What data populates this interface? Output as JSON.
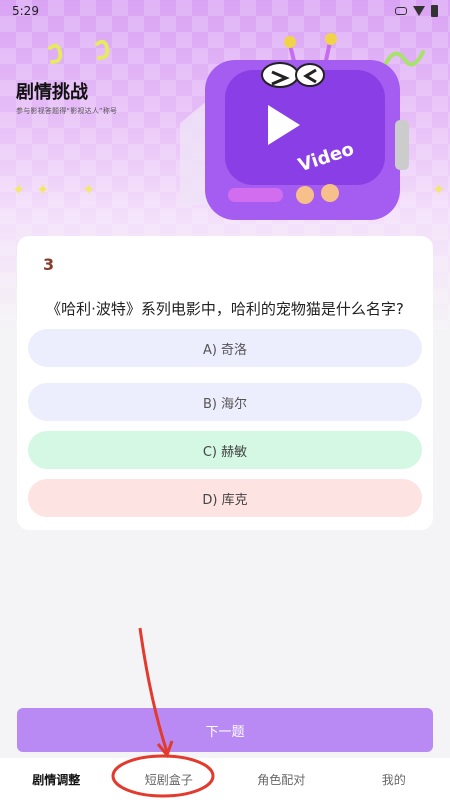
{
  "status_bar": {
    "time": "5:29"
  },
  "header": {
    "title": "剧情挑战",
    "subtitle": "参与影视答题得“影视达人”称号"
  },
  "illustration": {
    "tv_text": "Video"
  },
  "question": {
    "number": "3",
    "text": "《哈利·波特》系列电影中，哈利的宠物猫是什么名字?",
    "options": [
      {
        "label": "A) 奇洛",
        "state": "default"
      },
      {
        "label": "B) 海尔",
        "state": "default"
      },
      {
        "label": "C) 赫敏",
        "state": "correct"
      },
      {
        "label": "D) 库克",
        "state": "wrong"
      }
    ]
  },
  "next_button": {
    "label": "下一题"
  },
  "tabbar": {
    "tabs": [
      {
        "label": "剧情调整",
        "active": true
      },
      {
        "label": "短剧盒子",
        "active": false
      },
      {
        "label": "角色配对",
        "active": false
      },
      {
        "label": "我的",
        "active": false
      }
    ]
  },
  "colors": {
    "accent": "#b98af3",
    "correct_bg": "#d4f8e4",
    "wrong_bg": "#fde3e1",
    "option_bg": "#ecedfd",
    "annotation_red": "#e23b2e"
  }
}
